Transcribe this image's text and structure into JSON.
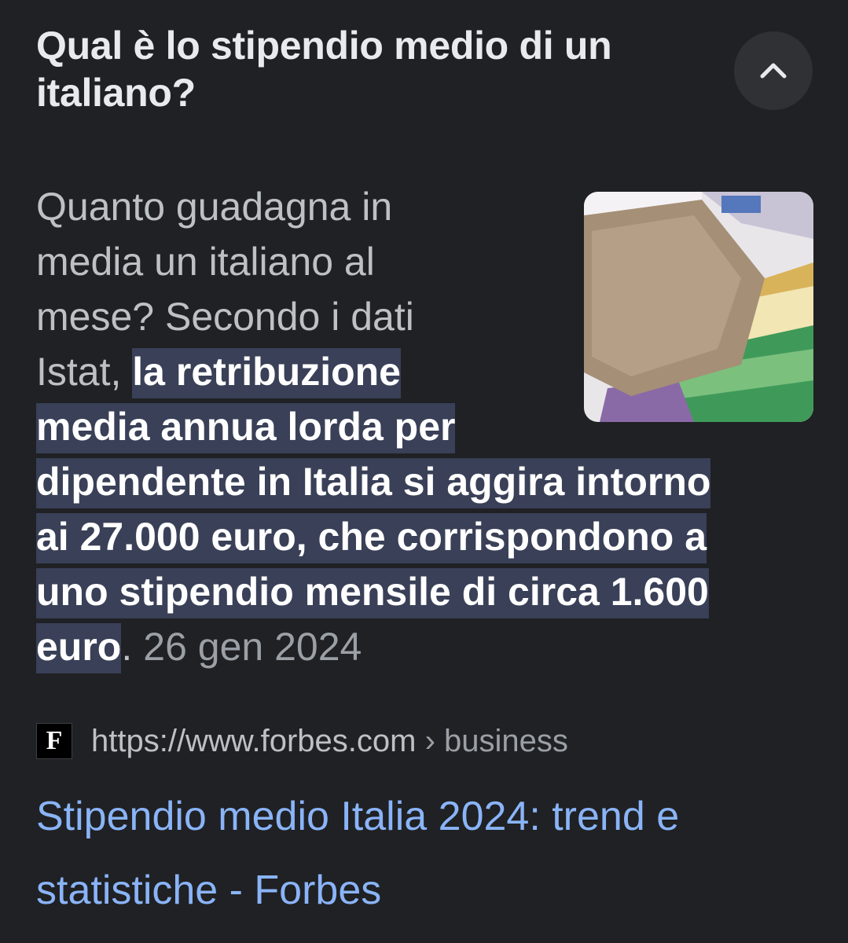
{
  "question": "Qual è lo stipendio medio di un italiano?",
  "collapse_icon": "chevron-up-icon",
  "answer": {
    "lines": [
      {
        "plain": "Quanto guadagna in",
        "highlight": ""
      },
      {
        "plain": "media un italiano al",
        "highlight": ""
      },
      {
        "plain": "mese? Secondo i dati",
        "highlight": ""
      },
      {
        "plain": "Istat, ",
        "highlight": "la retribuzione"
      },
      {
        "plain": "",
        "highlight": "media annua lorda per"
      },
      {
        "plain": "",
        "highlight": "dipendente in Italia si aggira intorno"
      },
      {
        "plain": "",
        "highlight": "ai 27.000 euro, che corrispondono a"
      },
      {
        "plain": "",
        "highlight": "uno stipendio mensile di circa 1.600"
      },
      {
        "plain": "",
        "highlight": "euro"
      }
    ],
    "trailing_punct": ".",
    "date": "26 gen 2024"
  },
  "thumbnail": {
    "alt": "euro banknotes in envelope"
  },
  "source": {
    "favicon_letter": "F",
    "url": "https://www.forbes.com",
    "breadcrumb": "› business"
  },
  "result": {
    "title_line1": "Stipendio medio Italia 2024: trend e",
    "title_line2": "statistiche - Forbes"
  },
  "colors": {
    "background": "#202124",
    "highlight": "#394057",
    "link": "#8ab4f8"
  }
}
